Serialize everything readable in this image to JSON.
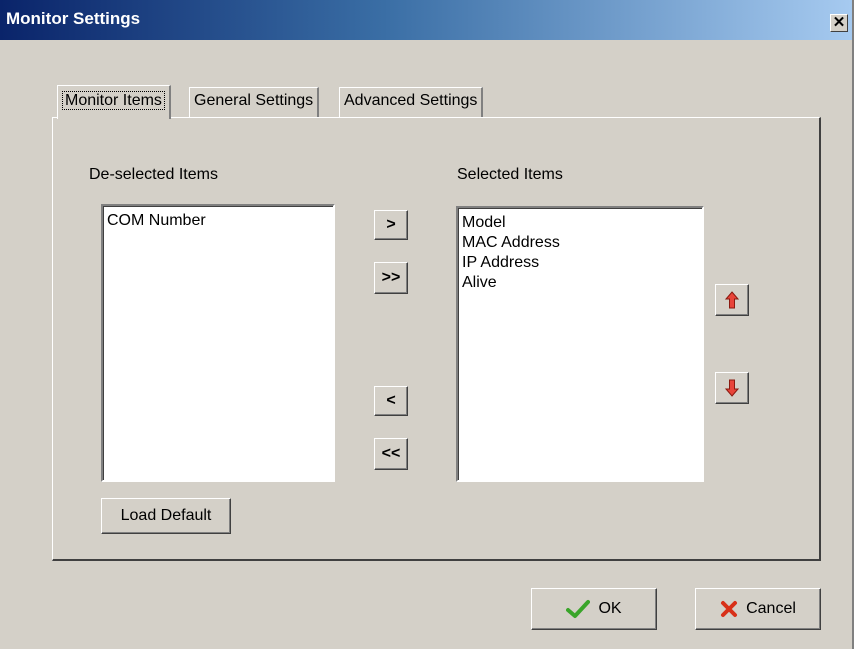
{
  "window": {
    "title": "Monitor Settings",
    "close_glyph": "✕"
  },
  "tabs": [
    {
      "label": "Monitor Items",
      "active": true
    },
    {
      "label": "General Settings",
      "active": false
    },
    {
      "label": "Advanced Settings",
      "active": false
    }
  ],
  "panel": {
    "deselected": {
      "label": "De-selected Items",
      "items": [
        "COM Number"
      ]
    },
    "selected": {
      "label": "Selected Items",
      "items": [
        "Model",
        "MAC Address",
        "IP Address",
        "Alive"
      ]
    },
    "buttons": {
      "add": ">",
      "add_all": ">>",
      "remove": "<",
      "remove_all": "<<",
      "load_default": "Load Default"
    },
    "move_up_icon": "arrow-up-icon",
    "move_down_icon": "arrow-down-icon"
  },
  "footer": {
    "ok_label": "OK",
    "cancel_label": "Cancel",
    "ok_icon": "checkmark-icon",
    "cancel_icon": "x-icon"
  },
  "colors": {
    "titlebar_start": "#0a246a",
    "arrow": "#e8443a",
    "ok_check": "#3aa52a",
    "cancel_x": "#d83018"
  }
}
